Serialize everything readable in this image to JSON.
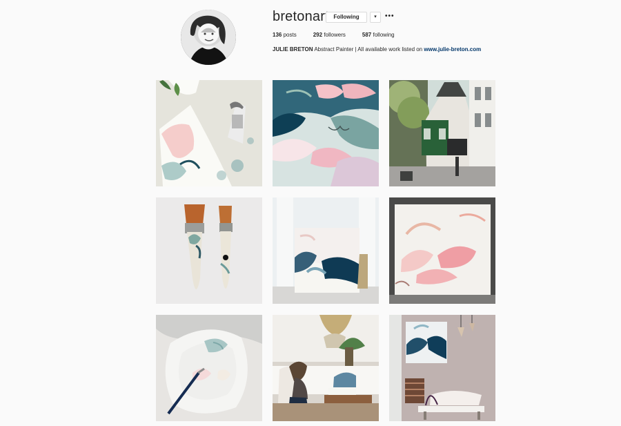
{
  "profile": {
    "username": "bretonart",
    "follow_button": "Following",
    "dropdown_icon": "▾",
    "more_icon": "•••",
    "stats": {
      "posts_value": "136",
      "posts_label": "posts",
      "followers_value": "292",
      "followers_label": "followers",
      "following_value": "587",
      "following_label": "following"
    },
    "bio": {
      "name": "JULIE BRETON",
      "text": "Abstract Painter | All available work listed on",
      "link": "www.julie-breton.com"
    }
  },
  "grid": {
    "posts": [
      {
        "icon": "paint-tube-photo"
      },
      {
        "icon": "abstract-painting-photo"
      },
      {
        "icon": "paris-street-photo"
      },
      {
        "icon": "paintbrushes-photo"
      },
      {
        "icon": "canvas-on-floor-photo"
      },
      {
        "icon": "pink-canvas-photo"
      },
      {
        "icon": "palette-plate-photo"
      },
      {
        "icon": "artist-living-room-photo"
      },
      {
        "icon": "living-room-art-photo"
      }
    ]
  }
}
